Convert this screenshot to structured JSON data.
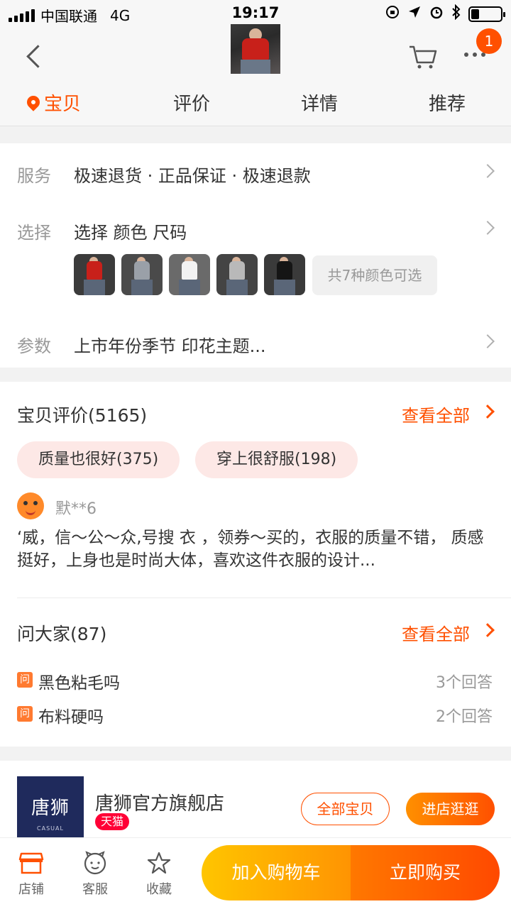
{
  "status_bar": {
    "carrier": "中国联通",
    "network": "4G",
    "time": "19:17",
    "battery_level": 0.28
  },
  "nav": {
    "cart_badge": "1"
  },
  "tabs": [
    {
      "label": "宝贝"
    },
    {
      "label": "评价"
    },
    {
      "label": "详情"
    },
    {
      "label": "推荐"
    }
  ],
  "service": {
    "label": "服务",
    "value": "极速退货 · 正品保证 · 极速退款"
  },
  "select": {
    "label": "选择",
    "value": "选择  颜色 尺码",
    "more_colors": "共7种颜色可选"
  },
  "params": {
    "label": "参数",
    "value": "上市年份季节 印花主题..."
  },
  "reviews": {
    "title": "宝贝评价(5165)",
    "view_all": "查看全部",
    "tags": [
      "质量也很好(375)",
      "穿上很舒服(198)"
    ],
    "reviewer": "默**6",
    "text": "‘威，信～公～众,号搜 衣     ，领券～买的，衣服的质量不错，  质感挺好，上身也是时尚大体，喜欢这件衣服的设计..."
  },
  "qa": {
    "title": "问大家(87)",
    "view_all": "查看全部",
    "icon_text": "问",
    "items": [
      {
        "question": "黑色粘毛吗",
        "answers": "3个回答"
      },
      {
        "question": "布料硬吗",
        "answers": "2个回答"
      }
    ]
  },
  "store": {
    "logo_text": "唐狮",
    "logo_sub": "CASUAL",
    "name": "唐狮官方旗舰店",
    "badge": "天猫",
    "all_items": "全部宝贝",
    "enter": "进店逛逛"
  },
  "bottom_bar": {
    "shop": "店铺",
    "service": "客服",
    "favorite": "收藏",
    "add_to_cart": "加入购物车",
    "buy_now": "立即购买"
  },
  "colors": {
    "accent": "#ff5000",
    "tmall": "#ff0036",
    "cart_start": "#ffc500",
    "buy_end": "#ff4900"
  }
}
